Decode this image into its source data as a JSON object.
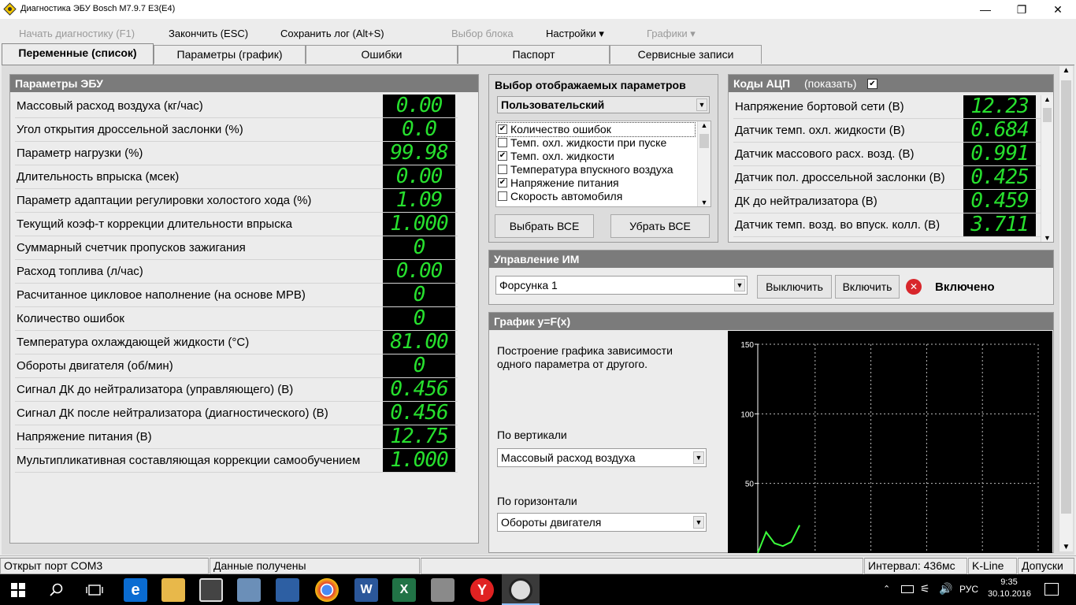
{
  "window": {
    "title": "Диагностика ЭБУ Bosch M7.9.7 E3(E4)",
    "minimize": "—",
    "restore": "❐",
    "close": "✕"
  },
  "menu": {
    "start_diag": "Начать диагностику (F1)",
    "finish": "Закончить (ESC)",
    "save_log": "Сохранить лог (Alt+S)",
    "select_block": "Выбор блока",
    "settings": "Настройки ▾",
    "graphs": "Графики ▾"
  },
  "tabs": [
    "Переменные (список)",
    "Параметры (график)",
    "Ошибки",
    "Паспорт",
    "Сервисные записи"
  ],
  "ecu": {
    "title": "Параметры ЭБУ",
    "rows": [
      {
        "label": "Массовый расход воздуха (кг/час)",
        "value": "0.00"
      },
      {
        "label": "Угол открытия дроссельной заслонки (%)",
        "value": "0.0"
      },
      {
        "label": "Параметр нагрузки (%)",
        "value": "99.98"
      },
      {
        "label": "Длительность впрыска (мсек)",
        "value": "0.00"
      },
      {
        "label": "Параметр адаптации регулировки холостого хода (%)",
        "value": "1.09"
      },
      {
        "label": "Текущий коэф-т коррекции длительности впрыска",
        "value": "1.000"
      },
      {
        "label": "Суммарный счетчик пропусков зажигания",
        "value": "0"
      },
      {
        "label": "Расход топлива (л/час)",
        "value": "0.00"
      },
      {
        "label": "Расчитанное цикловое наполнение (на основе МРВ)",
        "value": "0"
      },
      {
        "label": "Количество ошибок",
        "value": "0"
      },
      {
        "label": "Температура охлаждающей жидкости (°С)",
        "value": "81.00"
      },
      {
        "label": "Обороты двигателя (об/мин)",
        "value": "0"
      },
      {
        "label": "Сигнал ДК до нейтрализатора (управляющего) (В)",
        "value": "0.456"
      },
      {
        "label": "Сигнал ДК после нейтрализатора (диагностического) (В)",
        "value": "0.456"
      },
      {
        "label": "Напряжение питания (В)",
        "value": "12.75"
      },
      {
        "label": "Мультипликативная составляющая коррекции самообучением",
        "value": "1.000"
      }
    ]
  },
  "selector": {
    "title": "Выбор отображаемых параметров",
    "preset": "Пользовательский",
    "items": [
      {
        "label": "Количество ошибок",
        "checked": "✔"
      },
      {
        "label": "Темп. охл. жидкости при пуске",
        "checked": ""
      },
      {
        "label": "Темп. охл. жидкости",
        "checked": "✔"
      },
      {
        "label": "Температура впускного воздуха",
        "checked": ""
      },
      {
        "label": "Напряжение питания",
        "checked": "✔"
      },
      {
        "label": "Скорость автомобиля",
        "checked": ""
      }
    ],
    "select_all": "Выбрать ВСЕ",
    "clear_all": "Убрать ВСЕ"
  },
  "adc": {
    "title": "Коды АЦП",
    "show_label": "(показать)",
    "show_checked": "✔",
    "rows": [
      {
        "label": "Напряжение бортовой сети (В)",
        "value": "12.23"
      },
      {
        "label": "Датчик темп. охл. жидкости (В)",
        "value": "0.684"
      },
      {
        "label": "Датчик массового расх. возд. (В)",
        "value": "0.991"
      },
      {
        "label": "Датчик пол. дроссельной заслонки (В)",
        "value": "0.425"
      },
      {
        "label": "ДК до нейтрализатора (В)",
        "value": "0.459"
      },
      {
        "label": "Датчик темп. возд. во впуск. колл. (В)",
        "value": "3.711"
      }
    ]
  },
  "actuator": {
    "title": "Управление ИМ",
    "selected": "Форсунка 1",
    "off": "Выключить",
    "on": "Включить",
    "state": "Включено"
  },
  "graph": {
    "title": "График y=F(x)",
    "description": "Построение графика зависимости одного параметра от другого.",
    "vertical_label": "По вертикали",
    "vertical_value": "Массовый расход воздуха",
    "horizontal_label": "По горизонтали",
    "horizontal_value": "Обороты двигателя"
  },
  "chart_data": {
    "type": "line",
    "ylim": [
      0,
      150
    ],
    "yticks": [
      "150",
      "100",
      "50"
    ],
    "grid": true,
    "series": [
      {
        "x": [
          0,
          3,
          6,
          9,
          12,
          15
        ],
        "y": [
          0,
          15,
          7,
          5,
          8,
          20
        ]
      }
    ],
    "xlim": [
      0,
      100
    ],
    "color": "#3cff3c"
  },
  "status": {
    "port": "Открыт порт COM3",
    "data": "Данные получены",
    "interval": "Интервал: 436мс",
    "protocol": "K-Line",
    "tolerance": "Допуски"
  },
  "taskbar": {
    "lang": "РУС",
    "time": "9:35",
    "date": "30.10.2016"
  }
}
